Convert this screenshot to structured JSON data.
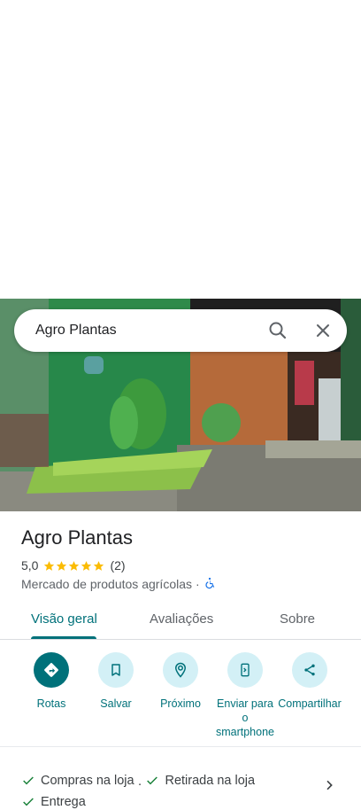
{
  "search": {
    "query": "Agro Plantas"
  },
  "place": {
    "name": "Agro Plantas",
    "rating": "5,0",
    "stars": 5,
    "review_count": "(2)",
    "category": "Mercado de produtos agrícolas",
    "separator": "·"
  },
  "tabs": [
    {
      "label": "Visão geral",
      "active": true
    },
    {
      "label": "Avaliações",
      "active": false
    },
    {
      "label": "Sobre",
      "active": false
    }
  ],
  "actions": [
    {
      "label": "Rotas",
      "icon": "directions-icon"
    },
    {
      "label": "Salvar",
      "icon": "bookmark-icon"
    },
    {
      "label": "Próximo",
      "icon": "nearby-icon"
    },
    {
      "label": "Enviar para o smartphone",
      "icon": "send-to-phone-icon"
    },
    {
      "label": "Compartilhar",
      "icon": "share-icon"
    }
  ],
  "services": {
    "item1": "Compras na loja",
    "sep": "·",
    "item2": "Retirada na loja",
    "item3": "Entrega"
  },
  "colors": {
    "accent": "#00717a",
    "star": "#fbbc04",
    "action_bg": "#d3f0f6"
  }
}
